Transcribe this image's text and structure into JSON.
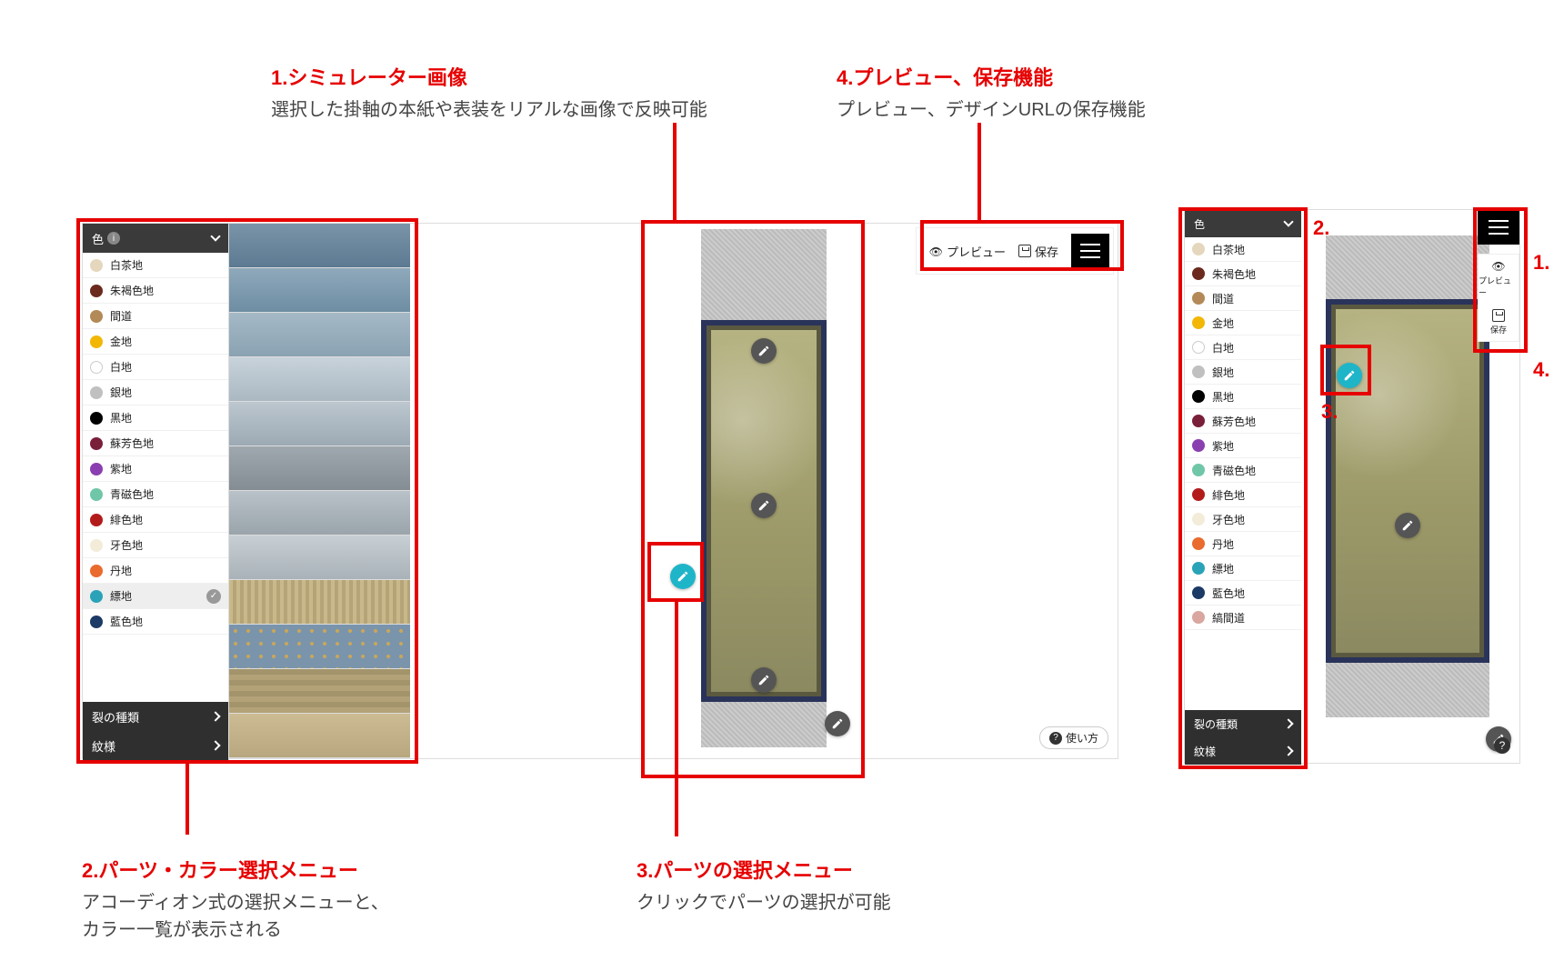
{
  "annotations": {
    "a1": {
      "title": "1.シミュレーター画像",
      "desc": "選択した掛軸の本紙や表装をリアルな画像で反映可能"
    },
    "a2": {
      "title": "2.パーツ・カラー選択メニュー",
      "desc1": "アコーディオン式の選択メニューと、",
      "desc2": "カラー一覧が表示される"
    },
    "a3": {
      "title": "3.パーツの選択メニュー",
      "desc": "クリックでパーツの選択が可能"
    },
    "a4": {
      "title": "4.プレビュー、保存機能",
      "desc": "プレビュー、デザインURLの保存機能"
    },
    "small_nums": {
      "n1": "1.",
      "n2": "2.",
      "n3": "3.",
      "n4": "4."
    }
  },
  "sidebar": {
    "header_color": "色",
    "header_type": "裂の種類",
    "header_pattern": "紋様",
    "colors": [
      {
        "label": "白茶地",
        "hex": "#e5d7bd"
      },
      {
        "label": "朱褐色地",
        "hex": "#6b2a1d"
      },
      {
        "label": "間道",
        "hex": "#b38a57"
      },
      {
        "label": "金地",
        "hex": "#f2b705"
      },
      {
        "label": "白地",
        "hex": "#ffffff"
      },
      {
        "label": "銀地",
        "hex": "#c0c0c0"
      },
      {
        "label": "黒地",
        "hex": "#000000"
      },
      {
        "label": "蘇芳色地",
        "hex": "#7a1f3a"
      },
      {
        "label": "紫地",
        "hex": "#8a3fb0"
      },
      {
        "label": "青磁色地",
        "hex": "#6fc7a8"
      },
      {
        "label": "緋色地",
        "hex": "#b31b1b"
      },
      {
        "label": "牙色地",
        "hex": "#f2ecd9"
      },
      {
        "label": "丹地",
        "hex": "#e96b2d"
      },
      {
        "label": "縹地",
        "hex": "#2aa3b8",
        "selected": true
      },
      {
        "label": "藍色地",
        "hex": "#1b3a66"
      }
    ],
    "colors_small_extra": {
      "label": "縞間道",
      "hex": "#d9a7a0"
    }
  },
  "toolbar": {
    "preview": "プレビュー",
    "save": "保存",
    "help": "使い方"
  },
  "swatch_colors": [
    "linear-gradient(#7a94a8,#5c7a92)",
    "linear-gradient(#8fa9bb,#6e8da3)",
    "linear-gradient(#a5b9c7,#8aa2b2)",
    "linear-gradient(#c8d3db,#aab8c2)",
    "linear-gradient(#bcc7cf,#9caab4)",
    "linear-gradient(#9fa8ae,#848d93)",
    "linear-gradient(#b9c2c8,#9aa4ab)",
    "linear-gradient(#c7cfd4,#a9b2b8)",
    "repeating-linear-gradient(90deg,#c9b98a,#c9b98a 4px,#b5a478 4px,#b5a478 8px)",
    "radial-gradient(#c9a65a 20%,transparent 21%) 0 0/14px 14px, #7a95ab",
    "repeating-linear-gradient(0deg,#b3a278,#b3a278 6px,#a3946b 6px,#a3946b 12px)",
    "linear-gradient(#cdbc93,#b8a77f)"
  ]
}
